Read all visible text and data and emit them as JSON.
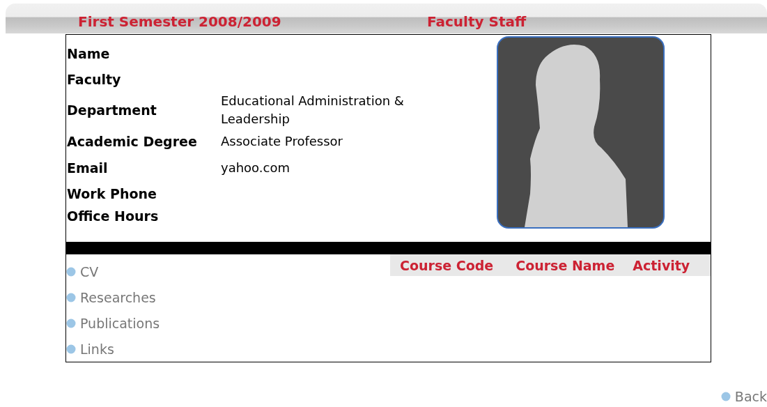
{
  "header": {
    "semester": "First Semester 2008/2009",
    "title": "Faculty Staff"
  },
  "fields": [
    {
      "label": "Name"
    },
    {
      "label": "Faculty"
    },
    {
      "label": "Department",
      "value": "Educational Administration & Leadership"
    },
    {
      "label": "Academic Degree",
      "value": "Associate Professor"
    },
    {
      "label": "Email",
      "value": "yahoo.com"
    },
    {
      "label": "Work Phone"
    },
    {
      "label": "Office Hours"
    }
  ],
  "links": [
    {
      "label": "CV"
    },
    {
      "label": "Researches"
    },
    {
      "label": "Publications"
    },
    {
      "label": "Links"
    }
  ],
  "courses": {
    "columns": [
      "Course Code",
      "Course Name",
      "Activity"
    ]
  },
  "back": "Back"
}
